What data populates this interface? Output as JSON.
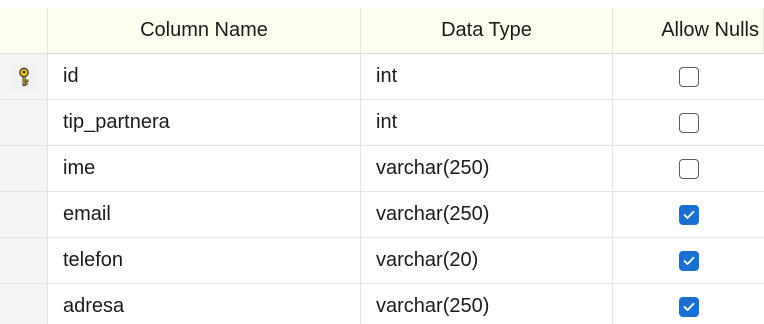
{
  "columns": {
    "name": "Column Name",
    "type": "Data Type",
    "nulls": "Allow Nulls"
  },
  "colors": {
    "header_bg": "#fffff0",
    "checkbox_checked": "#1a6fd0",
    "key_icon": "#d4a800"
  },
  "rows": [
    {
      "name": "id",
      "type": "int",
      "allow_nulls": false,
      "primary_key": true,
      "key_icon": "key-icon"
    },
    {
      "name": "tip_partnera",
      "type": "int",
      "allow_nulls": false
    },
    {
      "name": "ime",
      "type": "varchar(250)",
      "allow_nulls": false
    },
    {
      "name": "email",
      "type": "varchar(250)",
      "allow_nulls": true
    },
    {
      "name": "telefon",
      "type": "varchar(20)",
      "allow_nulls": true
    },
    {
      "name": "adresa",
      "type": "varchar(250)",
      "allow_nulls": true
    }
  ]
}
